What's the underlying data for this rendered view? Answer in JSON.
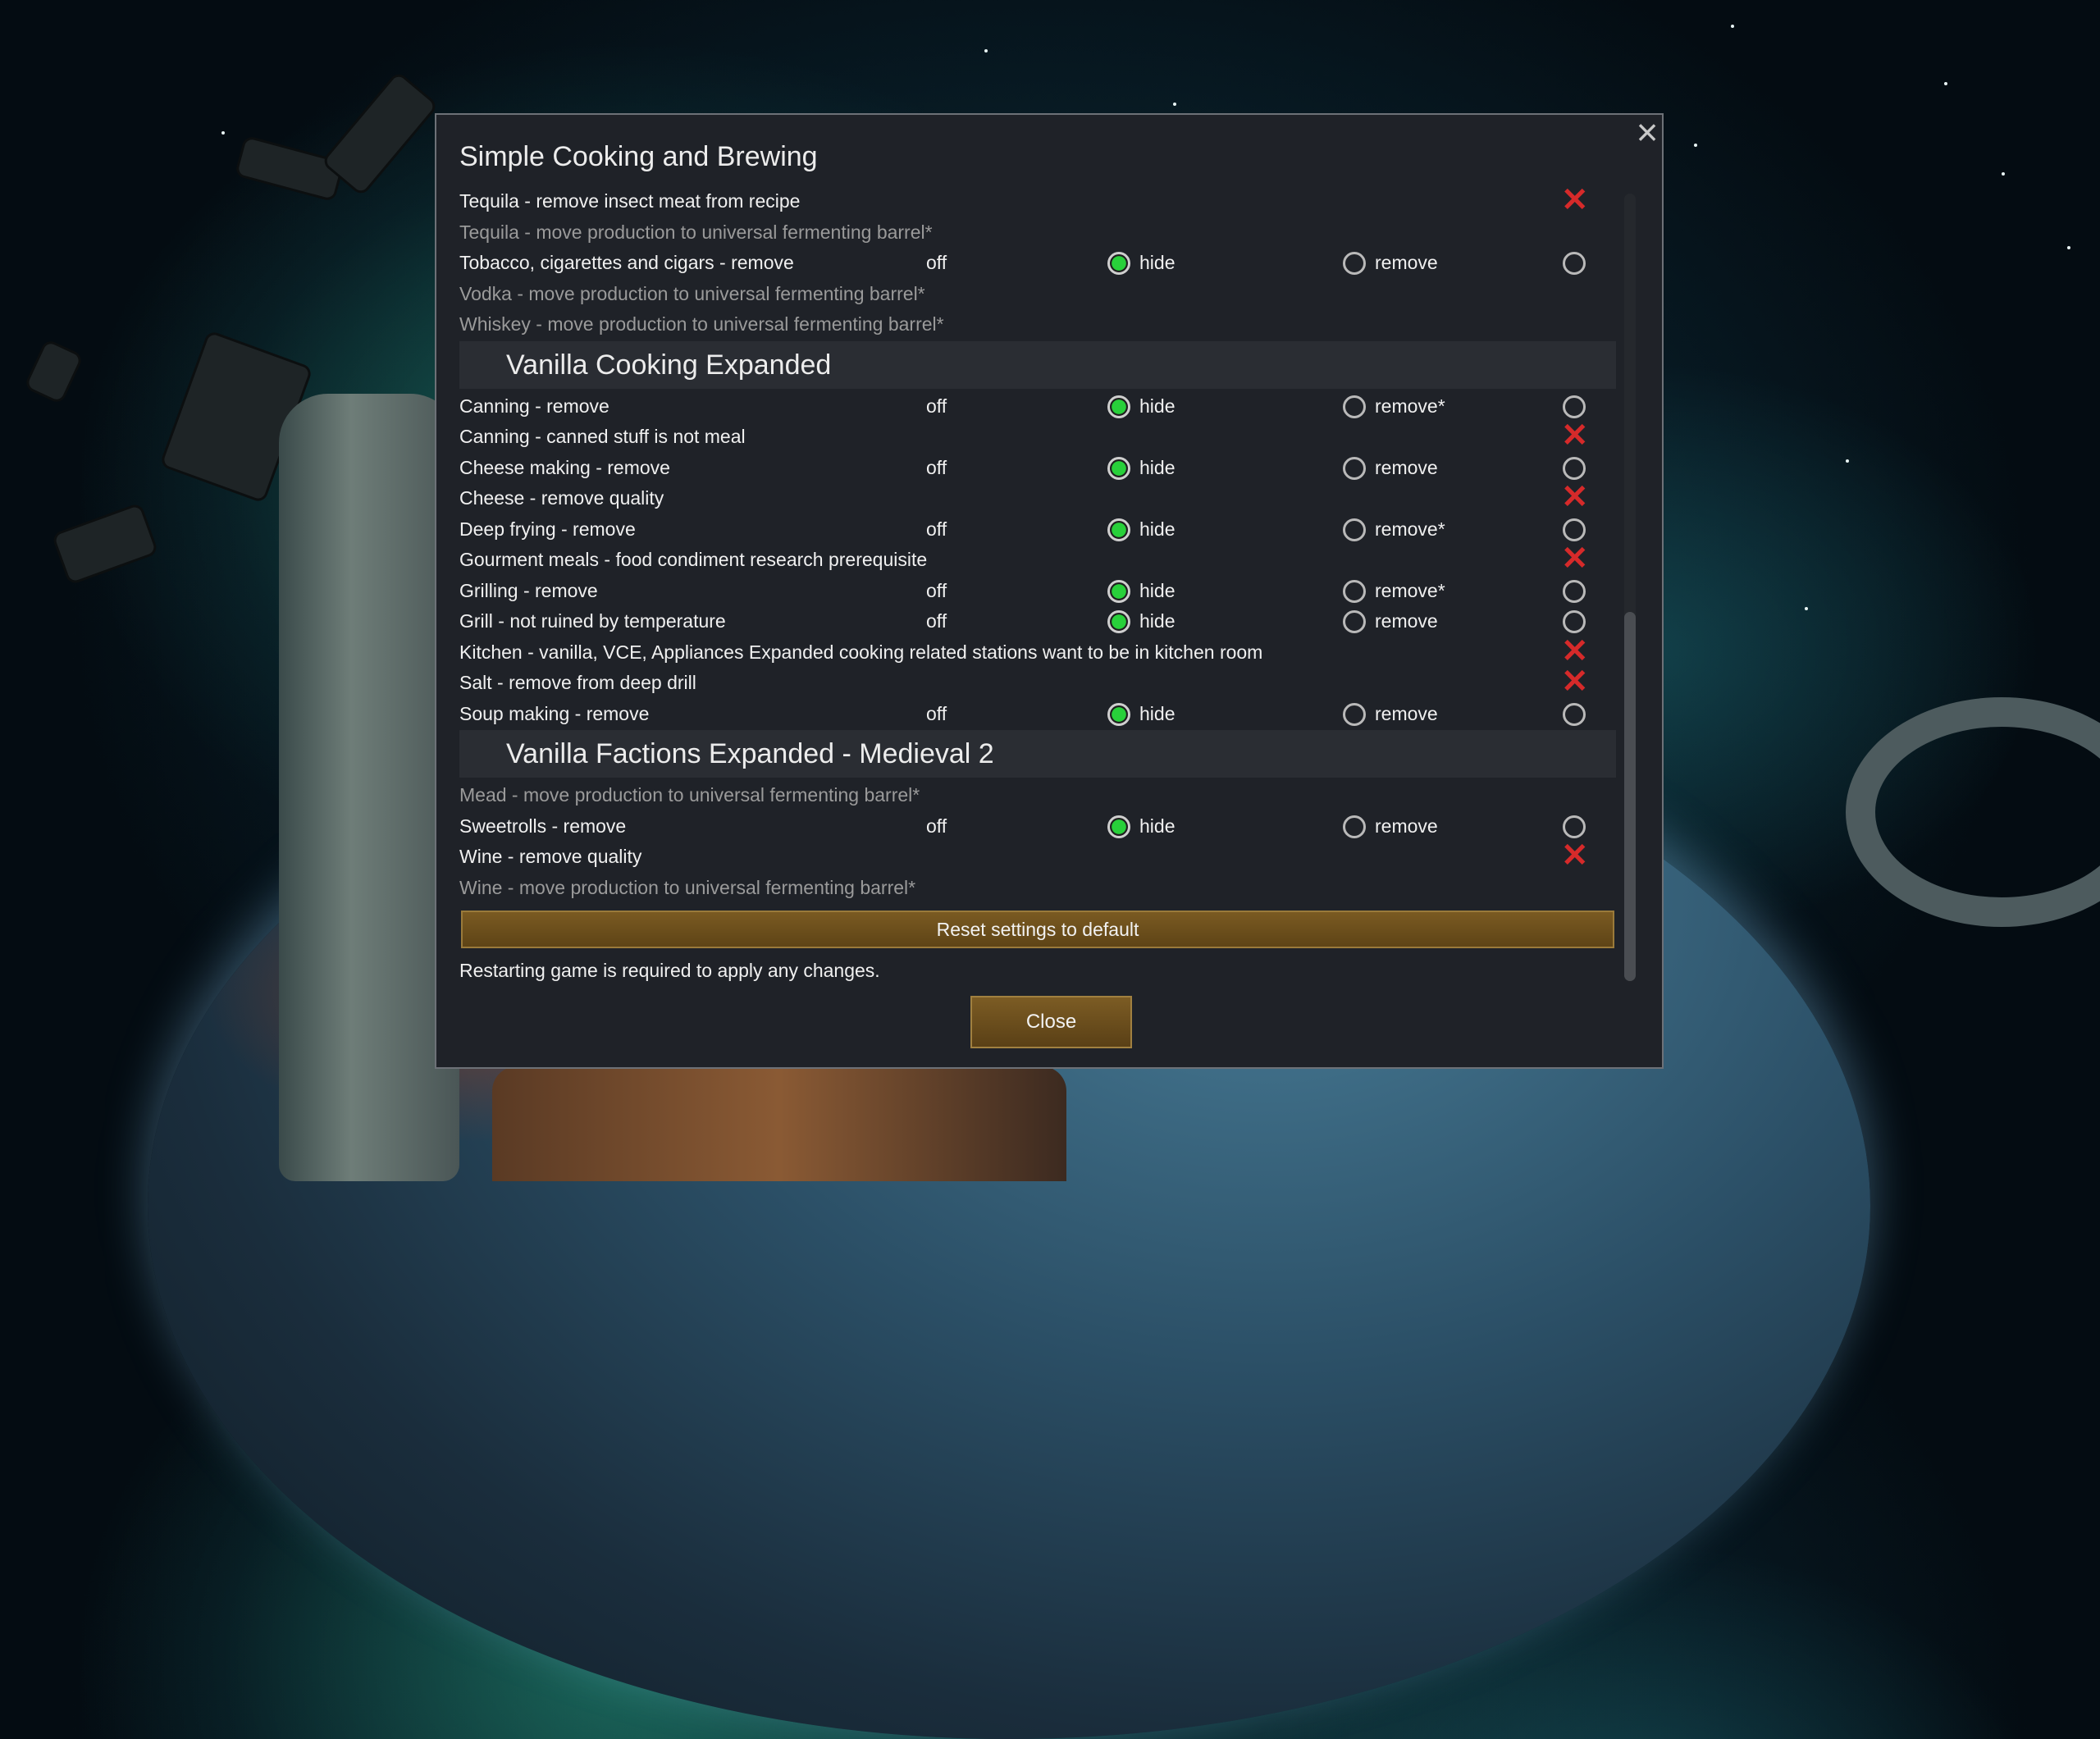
{
  "dialog": {
    "title": "Simple Cooking and Brewing",
    "close_icon": "close-icon",
    "rows": [
      {
        "type": "row",
        "label": "Tequila - remove insect meat from recipe",
        "dim": false,
        "mode": "x"
      },
      {
        "type": "row",
        "label": "Tequila - move production to universal fermenting barrel*",
        "dim": true,
        "mode": "none"
      },
      {
        "type": "row",
        "label": "Tobacco, cigarettes and cigars - remove",
        "dim": false,
        "mode": "radio",
        "off": "off",
        "hide": "hide",
        "remove": "remove",
        "selected": "hide"
      },
      {
        "type": "row",
        "label": "Vodka - move production to universal fermenting barrel*",
        "dim": true,
        "mode": "none"
      },
      {
        "type": "row",
        "label": "Whiskey - move production to universal fermenting barrel*",
        "dim": true,
        "mode": "none"
      },
      {
        "type": "section",
        "label": "Vanilla Cooking Expanded"
      },
      {
        "type": "row",
        "label": "Canning - remove",
        "dim": false,
        "mode": "radio",
        "off": "off",
        "hide": "hide",
        "remove": "remove*",
        "selected": "hide"
      },
      {
        "type": "row",
        "label": "Canning - canned stuff is not meal",
        "dim": false,
        "mode": "x"
      },
      {
        "type": "row",
        "label": "Cheese making - remove",
        "dim": false,
        "mode": "radio",
        "off": "off",
        "hide": "hide",
        "remove": "remove",
        "selected": "hide"
      },
      {
        "type": "row",
        "label": "Cheese - remove quality",
        "dim": false,
        "mode": "x"
      },
      {
        "type": "row",
        "label": "Deep frying - remove",
        "dim": false,
        "mode": "radio",
        "off": "off",
        "hide": "hide",
        "remove": "remove*",
        "selected": "hide"
      },
      {
        "type": "row",
        "label": "Gourment meals - food condiment research prerequisite",
        "dim": false,
        "mode": "x"
      },
      {
        "type": "row",
        "label": "Grilling - remove",
        "dim": false,
        "mode": "radio",
        "off": "off",
        "hide": "hide",
        "remove": "remove*",
        "selected": "hide"
      },
      {
        "type": "row",
        "label": "Grill - not ruined by temperature",
        "dim": false,
        "mode": "radio",
        "off": "off",
        "hide": "hide",
        "remove": "remove",
        "selected": "hide"
      },
      {
        "type": "row",
        "label": "Kitchen - vanilla, VCE, Appliances Expanded cooking related stations want to be in kitchen room",
        "dim": false,
        "mode": "x"
      },
      {
        "type": "row",
        "label": "Salt - remove from deep drill",
        "dim": false,
        "mode": "x"
      },
      {
        "type": "row",
        "label": "Soup making - remove",
        "dim": false,
        "mode": "radio",
        "off": "off",
        "hide": "hide",
        "remove": "remove",
        "selected": "hide"
      },
      {
        "type": "section",
        "label": "Vanilla Factions Expanded - Medieval 2"
      },
      {
        "type": "row",
        "label": "Mead - move production to universal fermenting barrel*",
        "dim": true,
        "mode": "none"
      },
      {
        "type": "row",
        "label": "Sweetrolls - remove",
        "dim": false,
        "mode": "radio",
        "off": "off",
        "hide": "hide",
        "remove": "remove",
        "selected": "hide"
      },
      {
        "type": "row",
        "label": "Wine - remove quality",
        "dim": false,
        "mode": "x"
      },
      {
        "type": "row",
        "label": "Wine - move production to universal fermenting barrel*",
        "dim": true,
        "mode": "none"
      }
    ],
    "reset_label": "Reset settings to default",
    "note": "Restarting game is required to apply any changes.",
    "close_label": "Close",
    "x_glyph": "✕"
  },
  "colors": {
    "selected_radio": "#28d03a",
    "x_mark": "#d62a2a",
    "button_gold": "#6e5020"
  }
}
